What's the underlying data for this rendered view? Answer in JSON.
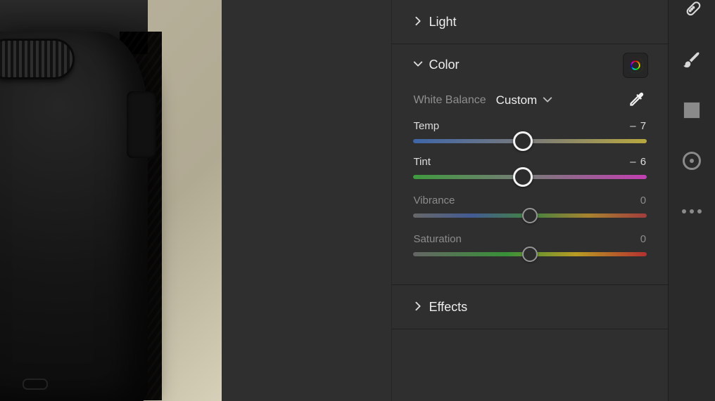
{
  "panels": {
    "light": {
      "title": "Light"
    },
    "color": {
      "title": "Color",
      "wb_label": "White Balance",
      "wb_value": "Custom",
      "sliders": {
        "temp": {
          "label": "Temp",
          "value": "– 7",
          "pos": 47,
          "active": true,
          "gradient": "g-temp"
        },
        "tint": {
          "label": "Tint",
          "value": "– 6",
          "pos": 47,
          "active": true,
          "gradient": "g-tint"
        },
        "vibrance": {
          "label": "Vibrance",
          "value": "0",
          "pos": 50,
          "active": false,
          "gradient": "g-vib"
        },
        "saturation": {
          "label": "Saturation",
          "value": "0",
          "pos": 50,
          "active": false,
          "gradient": "g-sat"
        }
      }
    },
    "effects": {
      "title": "Effects"
    }
  },
  "tool_icons": [
    "bandage-icon",
    "brush-icon",
    "square-icon",
    "radial-icon",
    "more-icon"
  ]
}
